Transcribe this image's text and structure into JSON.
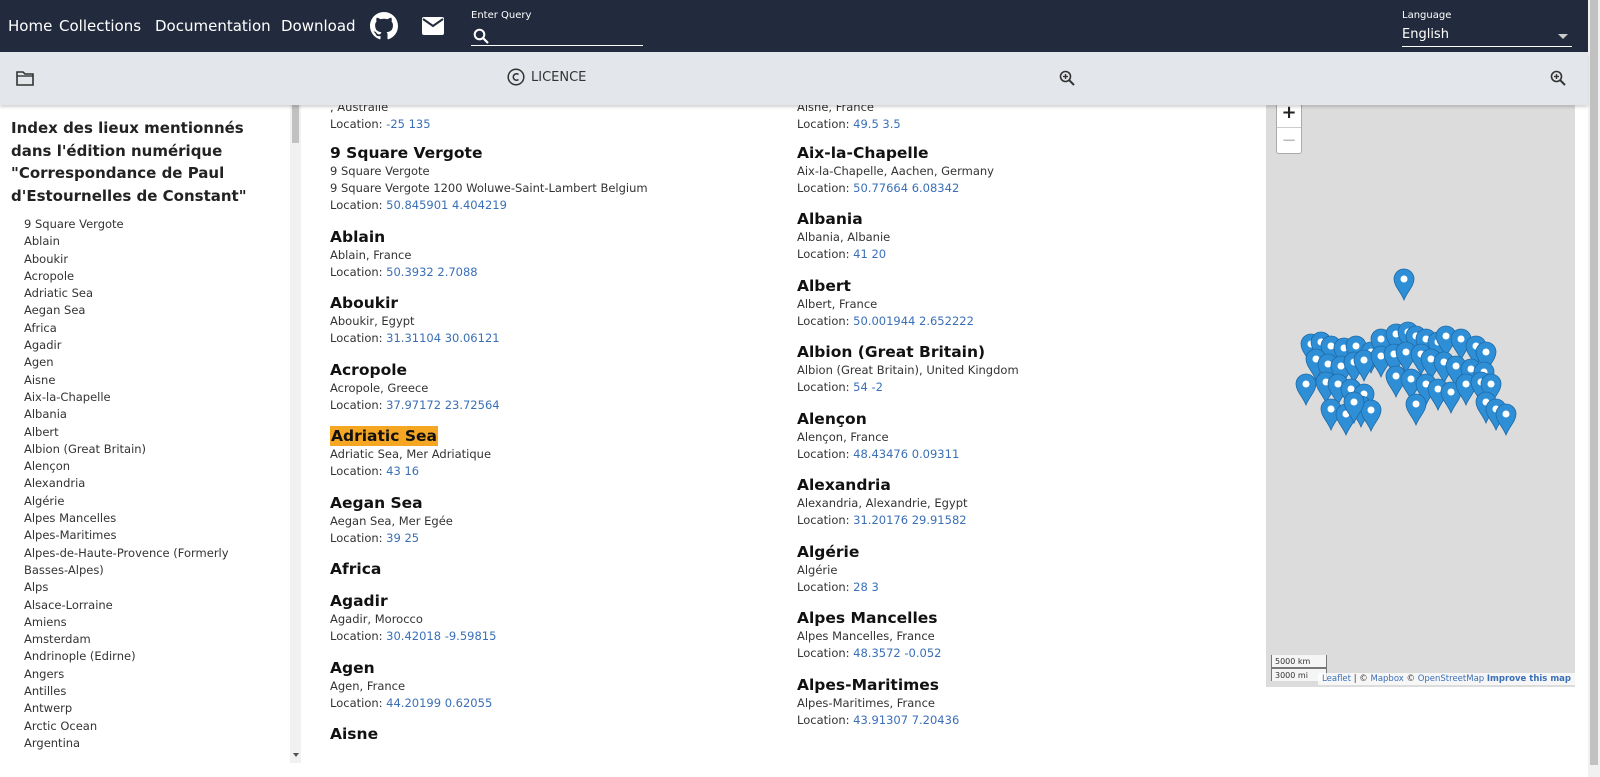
{
  "nav": {
    "home": "Home",
    "collections": "Collections",
    "documentation": "Documentation",
    "download": "Download",
    "query_label": "Enter Query",
    "query_value": "",
    "language_label": "Language",
    "language_value": "English"
  },
  "toolbar": {
    "licence": "LICENCE"
  },
  "sidebar": {
    "title": "Index des lieux mentionnés dans l'édition numérique \"Correspondance de Paul d'Estournelles de Constant\"",
    "items": [
      "9 Square Vergote",
      "Ablain",
      "Aboukir",
      "Acropole",
      "Adriatic Sea",
      "Aegan Sea",
      "Africa",
      "Agadir",
      "Agen",
      "Aisne",
      "Aix-la-Chapelle",
      "Albania",
      "Albert",
      "Albion (Great Britain)",
      "Alençon",
      "Alexandria",
      "Algérie",
      "Alpes Mancelles",
      "Alpes-Maritimes",
      "Alpes-de-Haute-Provence (Formerly",
      "Basses-Alpes)",
      "Alps",
      "Alsace-Lorraine",
      "Amiens",
      "Amsterdam",
      "Andrinople (Edirne)",
      "Angers",
      "Antilles",
      "Antwerp",
      "Arctic Ocean",
      "Argentina"
    ]
  },
  "entries_left": [
    {
      "name": "",
      "desc": ", Australie",
      "loc_label": "Location:",
      "loc": "-25 135"
    },
    {
      "name": "9 Square Vergote",
      "desc": "9 Square Vergote",
      "desc2": "9 Square Vergote 1200 Woluwe-Saint-Lambert Belgium",
      "loc_label": "Location:",
      "loc": "50.845901 4.404219"
    },
    {
      "name": "Ablain",
      "desc": "Ablain, France",
      "loc_label": "Location:",
      "loc": "50.3932 2.7088"
    },
    {
      "name": "Aboukir",
      "desc": "Aboukir, Egypt",
      "loc_label": "Location:",
      "loc": "31.31104 30.06121"
    },
    {
      "name": "Acropole",
      "desc": "Acropole, Greece",
      "loc_label": "Location:",
      "loc": "37.97172 23.72564"
    },
    {
      "name": "Adriatic Sea",
      "desc": "Adriatic Sea, Mer Adriatique",
      "loc_label": "Location:",
      "loc": "43 16"
    },
    {
      "name": "Aegan Sea",
      "desc": "Aegan Sea, Mer Egée",
      "loc_label": "Location:",
      "loc": "39 25"
    },
    {
      "name": "Africa"
    },
    {
      "name": "Agadir",
      "desc": "Agadir, Morocco",
      "loc_label": "Location:",
      "loc": "30.42018 -9.59815"
    },
    {
      "name": "Agen",
      "desc": "Agen, France",
      "loc_label": "Location:",
      "loc": "44.20199 0.62055"
    },
    {
      "name": "Aisne"
    }
  ],
  "entries_right": [
    {
      "desc": "Aisne, France",
      "loc_label": "Location:",
      "loc": "49.5 3.5"
    },
    {
      "name": "Aix-la-Chapelle",
      "desc": "Aix-la-Chapelle, Aachen, Germany",
      "loc_label": "Location:",
      "loc": "50.77664 6.08342"
    },
    {
      "name": "Albania",
      "desc": "Albania, Albanie",
      "loc_label": "Location:",
      "loc": "41 20"
    },
    {
      "name": "Albert",
      "desc": "Albert, France",
      "loc_label": "Location:",
      "loc": "50.001944 2.652222"
    },
    {
      "name": "Albion (Great Britain)",
      "desc": "Albion (Great Britain), United Kingdom",
      "loc_label": "Location:",
      "loc": "54 -2"
    },
    {
      "name": "Alençon",
      "desc": "Alençon, France",
      "loc_label": "Location:",
      "loc": "48.43476 0.09311"
    },
    {
      "name": "Alexandria",
      "desc": "Alexandria, Alexandrie, Egypt",
      "loc_label": "Location:",
      "loc": "31.20176 29.91582"
    },
    {
      "name": "Algérie",
      "desc": "Algérie",
      "loc_label": "Location:",
      "loc": "28 3"
    },
    {
      "name": "Alpes Mancelles",
      "desc": "Alpes Mancelles, France",
      "loc_label": "Location:",
      "loc": "48.3572 -0.052"
    },
    {
      "name": "Alpes-Maritimes",
      "desc": "Alpes-Maritimes, France",
      "loc_label": "Location:",
      "loc": "43.91307 7.20436"
    }
  ],
  "map": {
    "zoom_in": "+",
    "zoom_out": "−",
    "scale_km": "5000 km",
    "scale_mi": "3000 mi",
    "attrib_leaflet": "Leaflet",
    "attrib_sep1": " | © ",
    "attrib_mapbox": "Mapbox",
    "attrib_sep2": " © ",
    "attrib_osm": "OpenStreetMap",
    "attrib_improve": "Improve this map",
    "marker_color": "#2f8fd6"
  },
  "colors": {
    "navbar": "#222b3d",
    "toolbar": "#e3e6ea",
    "link": "#3a6fb7",
    "highlight": "#f5a623"
  }
}
